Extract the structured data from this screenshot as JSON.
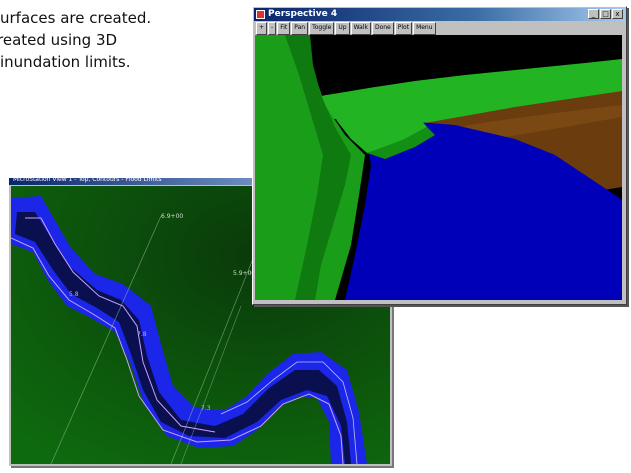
{
  "caption": {
    "line1": "urfaces are created.",
    "line2": "reated using 3D",
    "line3": "inundation limits."
  },
  "map_window": {
    "title": "MicroStation View 1 - Top, Contours - Flood Limits",
    "contour_labels": [
      "6.9+00",
      "5.9+00",
      "5.8",
      "7.3",
      "7.8"
    ]
  },
  "perspective_window": {
    "title": "Perspective 4",
    "toolbar": [
      "+",
      "-",
      "Fit",
      "Pan",
      "Toggle",
      "Up",
      "Walk",
      "Done",
      "Plot",
      "Menu"
    ],
    "controls": [
      "_",
      "□",
      "x"
    ]
  },
  "colors": {
    "water": "#0000b8",
    "terrain_green": "#1a9e1a",
    "bank_brown": "#6b3c0e",
    "sky": "#000000",
    "map_background": "#0b4d0b",
    "flood_zone": "#1b26e8",
    "channel": "#0a0f50"
  }
}
